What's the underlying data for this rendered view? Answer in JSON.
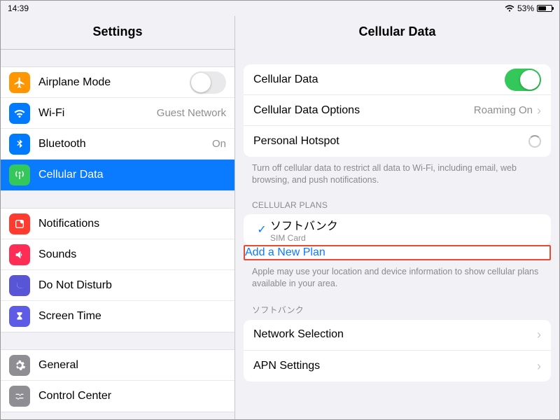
{
  "status": {
    "time": "14:39",
    "battery": "53%"
  },
  "sidebar": {
    "title": "Settings",
    "groups": [
      {
        "items": [
          {
            "label": "Airplane Mode",
            "value": ""
          },
          {
            "label": "Wi-Fi",
            "value": "Guest Network"
          },
          {
            "label": "Bluetooth",
            "value": "On"
          },
          {
            "label": "Cellular Data",
            "value": ""
          }
        ]
      },
      {
        "items": [
          {
            "label": "Notifications"
          },
          {
            "label": "Sounds"
          },
          {
            "label": "Do Not Disturb"
          },
          {
            "label": "Screen Time"
          }
        ]
      },
      {
        "items": [
          {
            "label": "General"
          },
          {
            "label": "Control Center"
          }
        ]
      }
    ]
  },
  "detail": {
    "title": "Cellular Data",
    "rows": {
      "cellular_data": "Cellular Data",
      "options": "Cellular Data Options",
      "options_value": "Roaming On",
      "hotspot": "Personal Hotspot"
    },
    "note1": "Turn off cellular data to restrict all data to Wi-Fi, including email, web browsing, and push notifications.",
    "plans_header": "CELLULAR PLANS",
    "plan_name": "ソフトバンク",
    "plan_sub": "SIM Card",
    "add_plan": "Add a New Plan",
    "note2": "Apple may use your location and device information to show cellular plans available in your area.",
    "carrier_header": "ソフトバンク",
    "network_selection": "Network Selection",
    "apn": "APN Settings"
  }
}
